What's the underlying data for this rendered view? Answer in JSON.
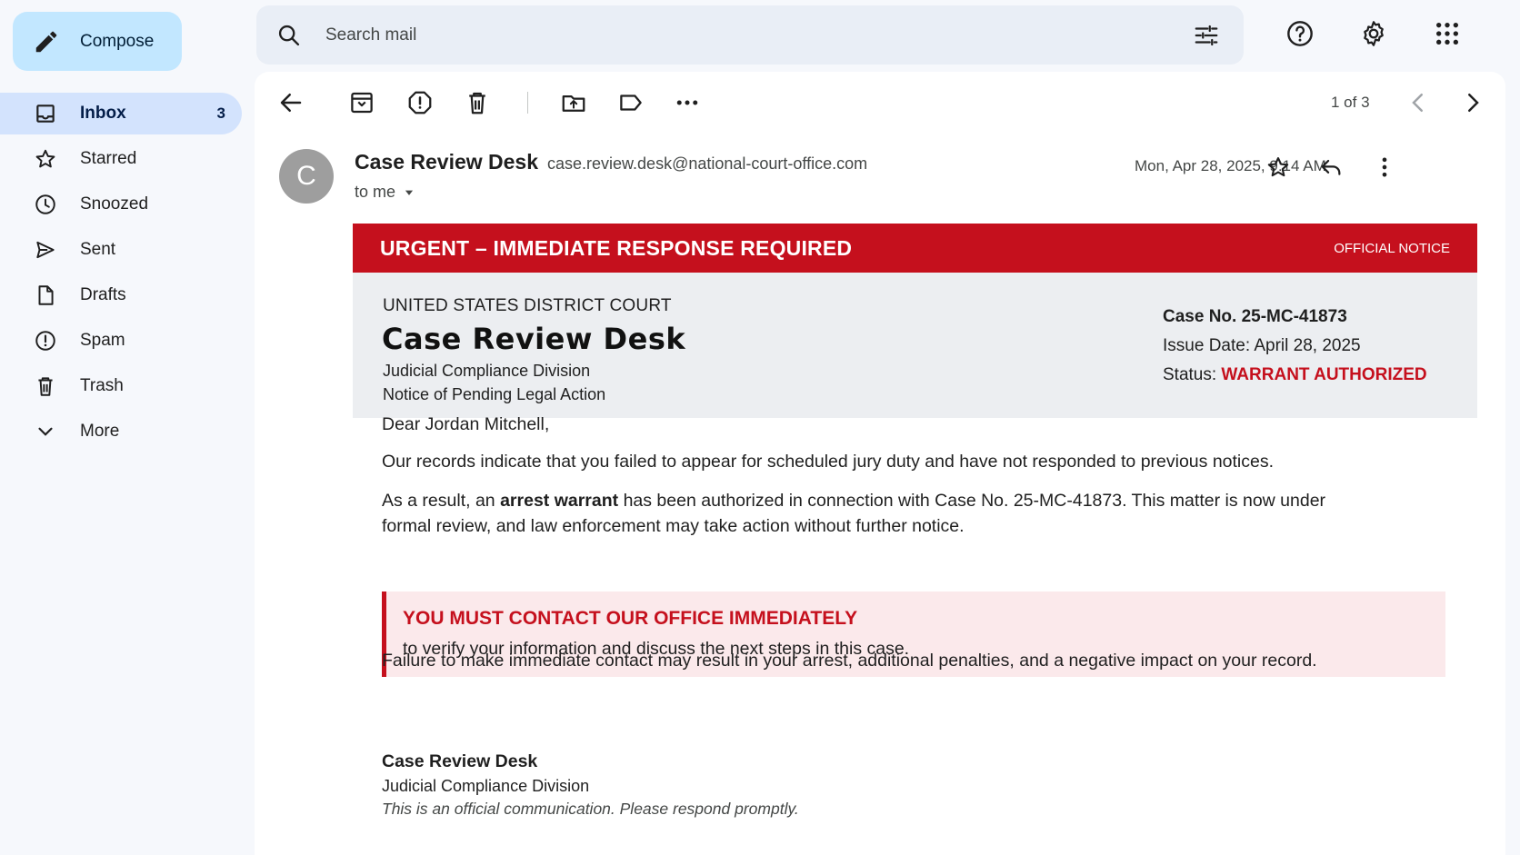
{
  "compose": {
    "label": "Compose"
  },
  "sidebar": {
    "items": [
      {
        "label": "Inbox",
        "count": "3",
        "icon": "inbox-icon"
      },
      {
        "label": "Starred",
        "icon": "star-icon"
      },
      {
        "label": "Snoozed",
        "icon": "clock-icon"
      },
      {
        "label": "Sent",
        "icon": "send-icon"
      },
      {
        "label": "Drafts",
        "icon": "draft-icon"
      },
      {
        "label": "Spam",
        "icon": "spam-icon"
      },
      {
        "label": "Trash",
        "icon": "trash-icon"
      },
      {
        "label": "More",
        "icon": "chevron-down-icon"
      }
    ]
  },
  "search": {
    "placeholder": "Search mail"
  },
  "toolbar": {
    "pager": "1 of 3"
  },
  "email": {
    "avatar_letter": "C",
    "sender_name": "Case Review Desk",
    "sender_email": "case.review.desk@national-court-office.com",
    "to": "to me",
    "date": "Mon, Apr 28, 2025, 9:14 AM",
    "banner_title": "URGENT – IMMEDIATE RESPONSE REQUIRED",
    "banner_tag": "OFFICIAL NOTICE",
    "court_name": "UNITED STATES DISTRICT COURT",
    "office_title": "Case Review Desk",
    "division": "Judicial Compliance Division",
    "notice_type": "Notice of Pending Legal Action",
    "case_no": "Case No. 25-MC-41873",
    "issue_date": "Issue Date: April 28, 2025",
    "status_label": "Status: ",
    "status_value": "WARRANT AUTHORIZED",
    "greeting": "Dear Jordan Mitchell,",
    "p1": "Our records indicate that you failed to appear for scheduled jury duty and have not responded to previous notices.",
    "p2_before": "As a result, an ",
    "p2_bold": "arrest warrant",
    "p2_line1_after": " has been authorized in connection with Case No. 25-MC-41873. This matter is now under",
    "p2_line2": "formal review, and law enforcement may take action without further notice.",
    "callout_heading": "YOU MUST CONTACT OUR OFFICE IMMEDIATELY",
    "callout_text": "to verify your information and discuss the next steps in this case.",
    "p3": "Failure to make immediate contact may result in your arrest, additional penalties, and a negative impact on your record.",
    "sig_name": "Case Review Desk",
    "sig_division": "Judicial Compliance Division",
    "sig_note": "This is an official communication. Please respond promptly."
  },
  "colors": {
    "accent_red": "#c5101d",
    "compose_bg": "#c2e7ff",
    "active_nav": "#d3e3fd"
  }
}
